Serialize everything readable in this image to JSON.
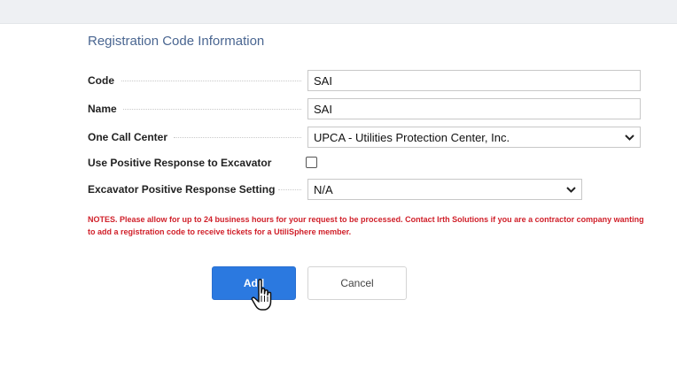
{
  "form": {
    "title": "Registration Code Information",
    "code": {
      "label": "Code",
      "value": "SAI"
    },
    "name": {
      "label": "Name",
      "value": "SAI"
    },
    "one_call_center": {
      "label": "One Call Center",
      "selected": "UPCA - Utilities Protection Center, Inc."
    },
    "use_positive_response": {
      "label": "Use Positive Response to Excavator",
      "checked": false
    },
    "excavator_setting": {
      "label": "Excavator Positive Response Setting",
      "selected": "N/A"
    },
    "notes": "NOTES. Please allow for up to 24 business hours for your request to be processed. Contact Irth Solutions if you are a contractor company wanting to add a registration code to receive tickets for a UtiliSphere member.",
    "add_label": "Add",
    "cancel_label": "Cancel"
  },
  "icons": {
    "dropdown": "chevron-down-icon",
    "cursor": "hand-pointer-icon"
  },
  "colors": {
    "title": "#4a6691",
    "notes": "#d0202a",
    "primary_button": "#2b79e0"
  }
}
